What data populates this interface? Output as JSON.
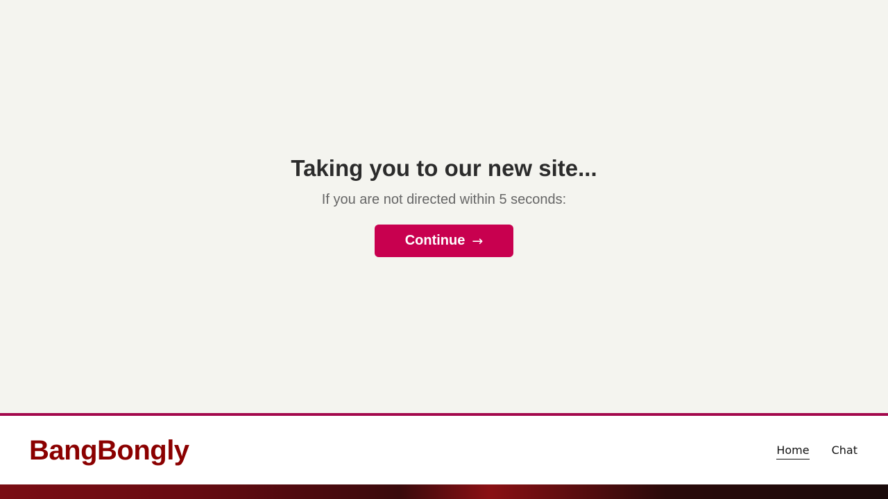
{
  "redirect": {
    "title": "Taking you to our new site...",
    "subtitle": "If you are not directed within 5 seconds:",
    "button_label": "Continue",
    "button_arrow": "→"
  },
  "header": {
    "logo": "BangBongly",
    "nav": [
      {
        "label": "Home",
        "active": true
      },
      {
        "label": "Chat",
        "active": false
      }
    ]
  },
  "colors": {
    "background": "#f4f4ef",
    "accent": "#c8004f",
    "header_border": "#a3084c",
    "logo": "#8b0000"
  }
}
